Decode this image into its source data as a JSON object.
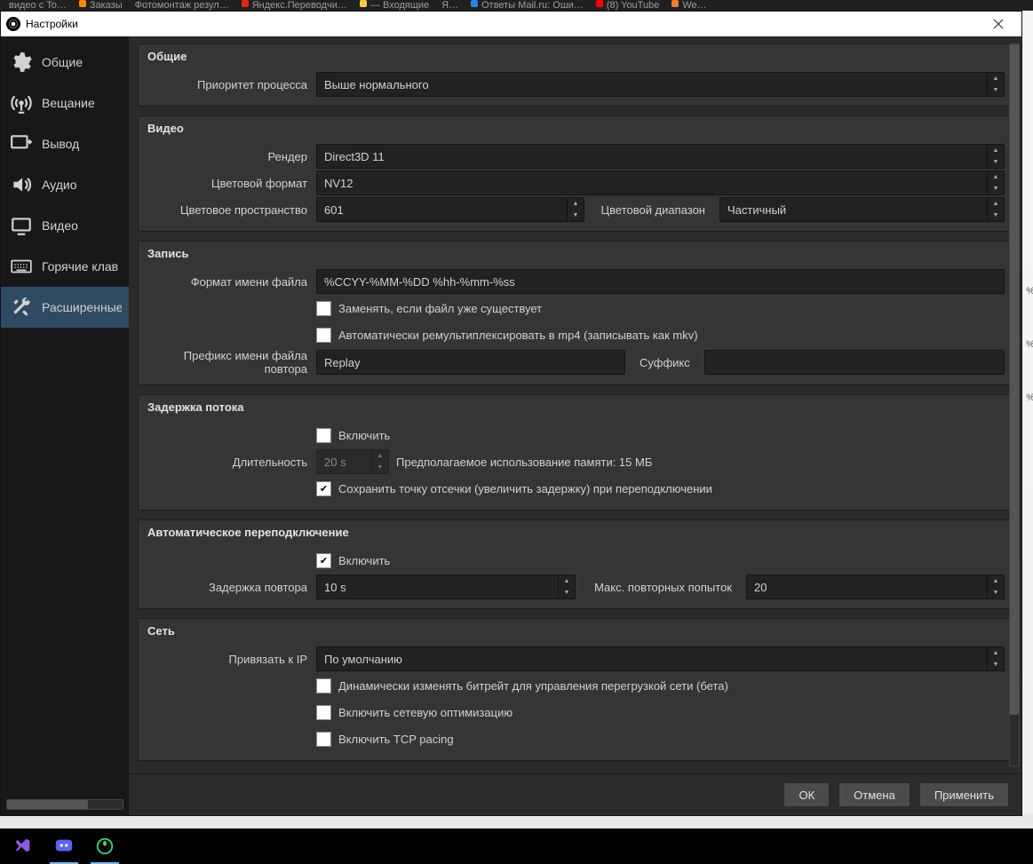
{
  "window": {
    "title": "Настройки"
  },
  "tabs": [
    "видео с To…",
    "Заказы",
    "Фотомонтаж резул…",
    "Яндекс.Переводчи…",
    "— Входящие",
    "Я…",
    "Ответы Mail.ru: Оши…",
    "(8) YouTube",
    "We…"
  ],
  "sidebar": {
    "items": [
      {
        "label": "Общие"
      },
      {
        "label": "Вещание"
      },
      {
        "label": "Вывод"
      },
      {
        "label": "Аудио"
      },
      {
        "label": "Видео"
      },
      {
        "label": "Горячие клав"
      },
      {
        "label": "Расширенные"
      }
    ]
  },
  "sections": {
    "general": {
      "title": "Общие",
      "priority_label": "Приоритет процесса",
      "priority_value": "Выше нормального"
    },
    "video": {
      "title": "Видео",
      "renderer_label": "Рендер",
      "renderer_value": "Direct3D 11",
      "fmt_label": "Цветовой формат",
      "fmt_value": "NV12",
      "space_label": "Цветовое пространство",
      "space_value": "601",
      "range_label": "Цветовой диапазон",
      "range_value": "Частичный"
    },
    "recording": {
      "title": "Запись",
      "filefmt_label": "Формат имени файла",
      "filefmt_value": "%CCYY-%MM-%DD %hh-%mm-%ss",
      "overwrite": "Заменять, если файл уже существует",
      "remux": "Автоматически ремультиплексировать в mp4 (записывать как mkv)",
      "replay_prefix_label": "Префикс имени файла повтора",
      "replay_prefix_value": "Replay",
      "replay_suffix_label": "Суффикс",
      "replay_suffix_value": ""
    },
    "delay": {
      "title": "Задержка потока",
      "enable": "Включить",
      "duration_label": "Длительность",
      "duration_value": "20 s",
      "memory_hint": "Предполагаемое использование памяти: 15 МБ",
      "preserve": "Сохранить точку отсечки (увеличить задержку) при переподключении"
    },
    "reconnect": {
      "title": "Автоматическое переподключение",
      "enable": "Включить",
      "retry_delay_label": "Задержка повтора",
      "retry_delay_value": "10 s",
      "max_label": "Макс. повторных попыток",
      "max_value": "20"
    },
    "network": {
      "title": "Сеть",
      "bind_label": "Привязать к IP",
      "bind_value": "По умолчанию",
      "dyn_bitrate": "Динамически изменять битрейт для управления перегрузкой сети (бета)",
      "net_opt": "Включить сетевую оптимизацию",
      "tcp_pacing": "Включить TCP pacing"
    }
  },
  "footer": {
    "ok": "ОК",
    "cancel": "Отмена",
    "apply": "Применить"
  }
}
